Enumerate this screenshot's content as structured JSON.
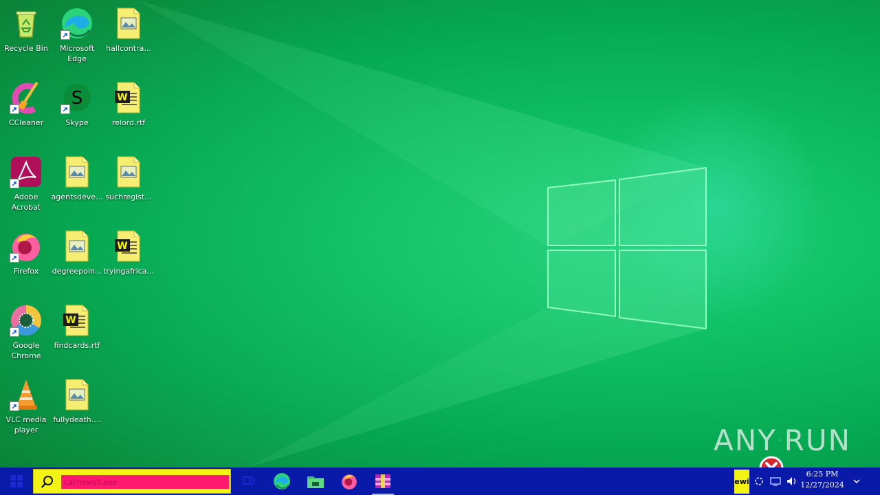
{
  "desktop": {
    "icons": [
      {
        "label": "Recycle Bin"
      },
      {
        "label": "Microsoft Edge"
      },
      {
        "label": "hallcontra..."
      },
      {
        "label": "CCleaner"
      },
      {
        "label": "Skype"
      },
      {
        "label": "relord.rtf"
      },
      {
        "label": "Adobe Acrobat"
      },
      {
        "label": "agentsdeve..."
      },
      {
        "label": "suchregist..."
      },
      {
        "label": "Firefox"
      },
      {
        "label": "degreepoin..."
      },
      {
        "label": "tryingafrica..."
      },
      {
        "label": "Google Chrome"
      },
      {
        "label": "findcards.rtf"
      },
      {
        "label": "VLC media player"
      },
      {
        "label": "fullydeath...."
      }
    ]
  },
  "watermark": {
    "left": "ANY",
    "right": "RUN"
  },
  "taskbar": {
    "search_value": "callnewsh.exe",
    "tray_badge": "ewi",
    "clock": {
      "time": "6:25 PM",
      "date": "12/27/2024"
    }
  }
}
